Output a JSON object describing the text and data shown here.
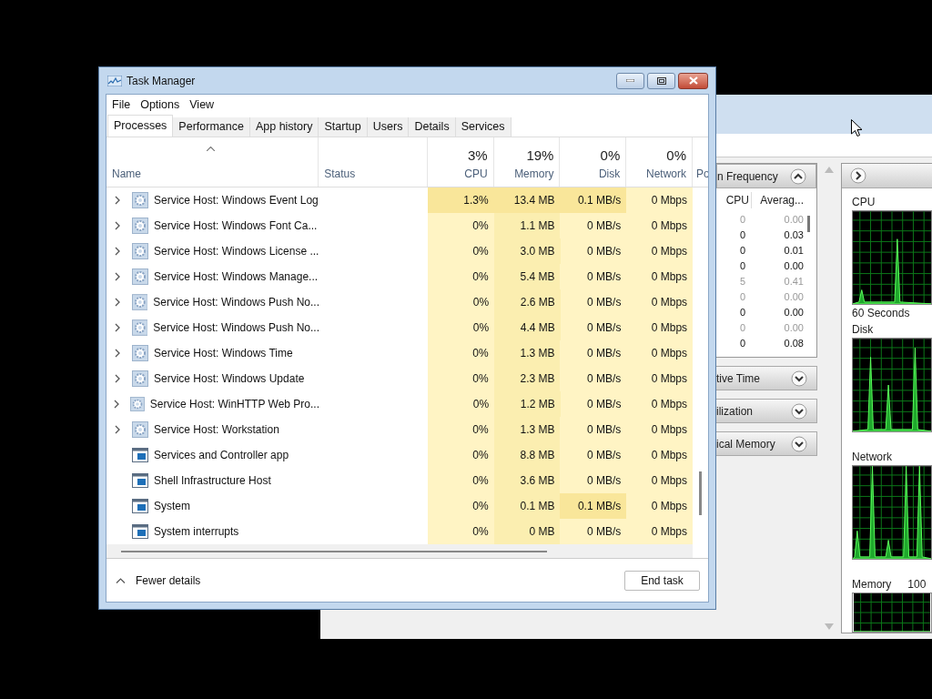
{
  "task_manager": {
    "title": "Task Manager",
    "menu": [
      "File",
      "Options",
      "View"
    ],
    "tabs": [
      {
        "label": "Processes",
        "selected": true
      },
      {
        "label": "Performance",
        "selected": false
      },
      {
        "label": "App history",
        "selected": false
      },
      {
        "label": "Startup",
        "selected": false
      },
      {
        "label": "Users",
        "selected": false
      },
      {
        "label": "Details",
        "selected": false
      },
      {
        "label": "Services",
        "selected": false
      }
    ],
    "columns": [
      {
        "label": "Name",
        "kind": "name"
      },
      {
        "label": "Status",
        "kind": "status"
      },
      {
        "usage": "3%",
        "label": "CPU",
        "kind": "metric"
      },
      {
        "usage": "19%",
        "label": "Memory",
        "kind": "metric"
      },
      {
        "usage": "0%",
        "label": "Disk",
        "kind": "metric"
      },
      {
        "usage": "0%",
        "label": "Network",
        "kind": "metric"
      },
      {
        "label": "Po",
        "kind": "partial"
      }
    ],
    "rows": [
      {
        "kind": "service",
        "expandable": true,
        "cells": [
          {
            "text": "Service Host: Windows Event Log"
          },
          {
            "text": ""
          },
          {
            "text": "1.3%",
            "hot": true
          },
          {
            "text": "13.4 MB",
            "hot": true
          },
          {
            "text": "0.1 MB/s",
            "hot": true
          },
          {
            "text": "0 Mbps",
            "hot": false
          }
        ]
      },
      {
        "kind": "service",
        "expandable": true,
        "cells": [
          {
            "text": "Service Host: Windows Font Ca..."
          },
          {
            "text": ""
          },
          {
            "text": "0%",
            "hot": false
          },
          {
            "text": "1.1 MB",
            "hot": false
          },
          {
            "text": "0 MB/s",
            "hot": false
          },
          {
            "text": "0 Mbps",
            "hot": false
          }
        ]
      },
      {
        "kind": "service",
        "expandable": true,
        "cells": [
          {
            "text": "Service Host: Windows License ..."
          },
          {
            "text": ""
          },
          {
            "text": "0%",
            "hot": false
          },
          {
            "text": "3.0 MB",
            "hot": false
          },
          {
            "text": "0 MB/s",
            "hot": false
          },
          {
            "text": "0 Mbps",
            "hot": false
          }
        ]
      },
      {
        "kind": "service",
        "expandable": true,
        "cells": [
          {
            "text": "Service Host: Windows Manage..."
          },
          {
            "text": ""
          },
          {
            "text": "0%",
            "hot": false
          },
          {
            "text": "5.4 MB",
            "hot": false
          },
          {
            "text": "0 MB/s",
            "hot": false
          },
          {
            "text": "0 Mbps",
            "hot": false
          }
        ]
      },
      {
        "kind": "service",
        "expandable": true,
        "cells": [
          {
            "text": "Service Host: Windows Push No..."
          },
          {
            "text": ""
          },
          {
            "text": "0%",
            "hot": false
          },
          {
            "text": "2.6 MB",
            "hot": false
          },
          {
            "text": "0 MB/s",
            "hot": false
          },
          {
            "text": "0 Mbps",
            "hot": false
          }
        ]
      },
      {
        "kind": "service",
        "expandable": true,
        "cells": [
          {
            "text": "Service Host: Windows Push No..."
          },
          {
            "text": ""
          },
          {
            "text": "0%",
            "hot": false
          },
          {
            "text": "4.4 MB",
            "hot": false
          },
          {
            "text": "0 MB/s",
            "hot": false
          },
          {
            "text": "0 Mbps",
            "hot": false
          }
        ]
      },
      {
        "kind": "service",
        "expandable": true,
        "cells": [
          {
            "text": "Service Host: Windows Time"
          },
          {
            "text": ""
          },
          {
            "text": "0%",
            "hot": false
          },
          {
            "text": "1.3 MB",
            "hot": false
          },
          {
            "text": "0 MB/s",
            "hot": false
          },
          {
            "text": "0 Mbps",
            "hot": false
          }
        ]
      },
      {
        "kind": "service",
        "expandable": true,
        "cells": [
          {
            "text": "Service Host: Windows Update"
          },
          {
            "text": ""
          },
          {
            "text": "0%",
            "hot": false
          },
          {
            "text": "2.3 MB",
            "hot": false
          },
          {
            "text": "0 MB/s",
            "hot": false
          },
          {
            "text": "0 Mbps",
            "hot": false
          }
        ]
      },
      {
        "kind": "service",
        "expandable": true,
        "cells": [
          {
            "text": "Service Host: WinHTTP Web Pro..."
          },
          {
            "text": ""
          },
          {
            "text": "0%",
            "hot": false
          },
          {
            "text": "1.2 MB",
            "hot": false
          },
          {
            "text": "0 MB/s",
            "hot": false
          },
          {
            "text": "0 Mbps",
            "hot": false
          }
        ]
      },
      {
        "kind": "service",
        "expandable": true,
        "cells": [
          {
            "text": "Service Host: Workstation"
          },
          {
            "text": ""
          },
          {
            "text": "0%",
            "hot": false
          },
          {
            "text": "1.3 MB",
            "hot": false
          },
          {
            "text": "0 MB/s",
            "hot": false
          },
          {
            "text": "0 Mbps",
            "hot": false
          }
        ]
      },
      {
        "kind": "app",
        "expandable": false,
        "cells": [
          {
            "text": "Services and Controller app"
          },
          {
            "text": ""
          },
          {
            "text": "0%",
            "hot": false
          },
          {
            "text": "8.8 MB",
            "hot": false
          },
          {
            "text": "0 MB/s",
            "hot": false
          },
          {
            "text": "0 Mbps",
            "hot": false
          }
        ]
      },
      {
        "kind": "app",
        "expandable": false,
        "cells": [
          {
            "text": "Shell Infrastructure Host"
          },
          {
            "text": ""
          },
          {
            "text": "0%",
            "hot": false
          },
          {
            "text": "3.6 MB",
            "hot": false
          },
          {
            "text": "0 MB/s",
            "hot": false
          },
          {
            "text": "0 Mbps",
            "hot": false
          }
        ]
      },
      {
        "kind": "app",
        "expandable": false,
        "cells": [
          {
            "text": "System"
          },
          {
            "text": ""
          },
          {
            "text": "0%",
            "hot": false
          },
          {
            "text": "0.1 MB",
            "hot": false
          },
          {
            "text": "0.1 MB/s",
            "hot": true
          },
          {
            "text": "0 Mbps",
            "hot": false
          }
        ]
      },
      {
        "kind": "app",
        "expandable": false,
        "cells": [
          {
            "text": "System interrupts"
          },
          {
            "text": ""
          },
          {
            "text": "0%",
            "hot": false
          },
          {
            "text": "0 MB",
            "hot": false
          },
          {
            "text": "0 MB/s",
            "hot": false
          },
          {
            "text": "0 Mbps",
            "hot": false
          }
        ]
      }
    ],
    "footer": {
      "toggle": "Fewer details",
      "button": "End task"
    }
  },
  "background_window": {
    "panels": [
      {
        "title": "n Frequency",
        "expanded": true,
        "columns": [
          "CPU",
          "Averag..."
        ],
        "rows": [
          {
            "cpu": "0",
            "average": "0.00",
            "dimmed": true
          },
          {
            "cpu": "0",
            "average": "0.03",
            "dimmed": false
          },
          {
            "cpu": "0",
            "average": "0.01",
            "dimmed": false
          },
          {
            "cpu": "0",
            "average": "0.00",
            "dimmed": false
          },
          {
            "cpu": "5",
            "average": "0.41",
            "dimmed": true
          },
          {
            "cpu": "0",
            "average": "0.00",
            "dimmed": true
          },
          {
            "cpu": "0",
            "average": "0.00",
            "dimmed": false
          },
          {
            "cpu": "0",
            "average": "0.00",
            "dimmed": true
          },
          {
            "cpu": "0",
            "average": "0.08",
            "dimmed": false
          }
        ]
      },
      {
        "title": "tive Time",
        "expanded": false
      },
      {
        "title": "ilization",
        "expanded": false
      },
      {
        "title": "ical Memory",
        "expanded": false
      }
    ],
    "graphs": [
      {
        "label": "CPU",
        "footer": "60 Seconds"
      },
      {
        "label": "Disk"
      },
      {
        "label": "Network"
      },
      {
        "label": "Memory",
        "value": "100"
      }
    ]
  }
}
